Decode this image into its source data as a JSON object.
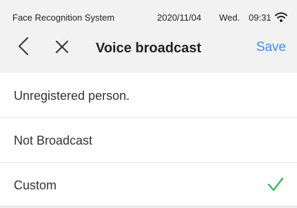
{
  "status_bar": {
    "app_name": "Face Recognition System",
    "date": "2020/11/04",
    "day": "Wed.",
    "time": "09:31",
    "wifi_icon": "wifi-icon"
  },
  "nav": {
    "back_icon": "chevron-left-icon",
    "close_icon": "close-icon",
    "title": "Voice broadcast",
    "save_label": "Save"
  },
  "options": [
    {
      "label": "Unregistered person.",
      "selected": false
    },
    {
      "label": "Not Broadcast",
      "selected": false
    },
    {
      "label": "Custom",
      "selected": true
    }
  ],
  "colors": {
    "accent": "#3a8ef0",
    "check": "#3cb55a",
    "header_bg": "#f2f2f2"
  }
}
